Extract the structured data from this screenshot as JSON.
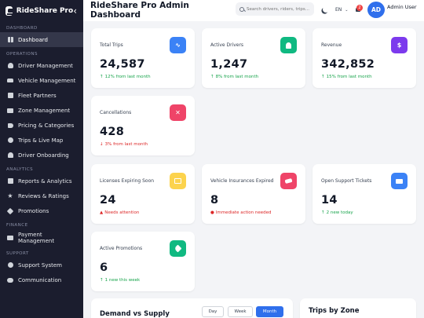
{
  "brand": {
    "name": "RideShare Pro"
  },
  "sidebar": {
    "sections": [
      {
        "title": "DASHBOARD",
        "items": [
          {
            "label": "Dashboard",
            "icon": "dashboard-icon",
            "active": true
          }
        ]
      },
      {
        "title": "OPERATIONS",
        "items": [
          {
            "label": "Driver Management",
            "icon": "driver-icon"
          },
          {
            "label": "Vehicle Management",
            "icon": "car-icon"
          },
          {
            "label": "Fleet Partners",
            "icon": "fleet-icon"
          },
          {
            "label": "Zone Management",
            "icon": "map-icon"
          },
          {
            "label": "Pricing & Categories",
            "icon": "tag-icon"
          },
          {
            "label": "Trips & Live Map",
            "icon": "route-icon"
          },
          {
            "label": "Driver Onboarding",
            "icon": "user-plus-icon"
          }
        ]
      },
      {
        "title": "ANALYTICS",
        "items": [
          {
            "label": "Reports & Analytics",
            "icon": "chart-icon"
          },
          {
            "label": "Reviews & Ratings",
            "icon": "star-icon"
          },
          {
            "label": "Promotions",
            "icon": "promo-icon"
          }
        ]
      },
      {
        "title": "FINANCE",
        "items": [
          {
            "label": "Payment Management",
            "icon": "wallet-icon"
          }
        ]
      },
      {
        "title": "SUPPORT",
        "items": [
          {
            "label": "Support System",
            "icon": "support-icon"
          },
          {
            "label": "Communication",
            "icon": "chat-icon"
          }
        ]
      }
    ]
  },
  "header": {
    "title": "RideShare Pro Admin Dashboard",
    "search_placeholder": "Search drivers, riders, trips...",
    "language": "EN",
    "notifications": "2",
    "avatar_initials": "AD",
    "user_name": "Admin User"
  },
  "stats": [
    {
      "label": "Total Trips",
      "value": "24,587",
      "sub": "12% from last month",
      "trend": "up",
      "color": "#3b82f6",
      "icon": "route-icon"
    },
    {
      "label": "Active Drivers",
      "value": "1,247",
      "sub": "8% from last month",
      "trend": "up",
      "color": "#10b981",
      "icon": "driver-icon"
    },
    {
      "label": "Revenue",
      "value": "342,852",
      "sub": "15% from last month",
      "trend": "up",
      "color": "#7c3aed",
      "icon": "dollar-icon"
    },
    {
      "label": "Cancellations",
      "value": "428",
      "sub": "3% from last month",
      "trend": "down",
      "color": "#ef4468",
      "icon": "close-icon"
    },
    {
      "label": "Licenses Expiring Soon",
      "value": "24",
      "sub": "Needs attention",
      "trend": "warn",
      "color": "#fcd34d",
      "icon": "id-card-icon"
    },
    {
      "label": "Vehicle Insurances Expired",
      "value": "8",
      "sub": "Immediate action needed",
      "trend": "alert",
      "color": "#ef4468",
      "icon": "car-icon"
    },
    {
      "label": "Open Support Tickets",
      "value": "14",
      "sub": "2 new today",
      "trend": "up",
      "color": "#3b82f6",
      "icon": "ticket-icon"
    },
    {
      "label": "Active Promotions",
      "value": "6",
      "sub": "1 new this week",
      "trend": "up",
      "color": "#10b981",
      "icon": "tag-icon"
    }
  ],
  "demand": {
    "title": "Demand vs Supply",
    "ranges": [
      "Day",
      "Week",
      "Month"
    ],
    "selected": "Month"
  },
  "zones": {
    "title": "Trips by Zone"
  }
}
